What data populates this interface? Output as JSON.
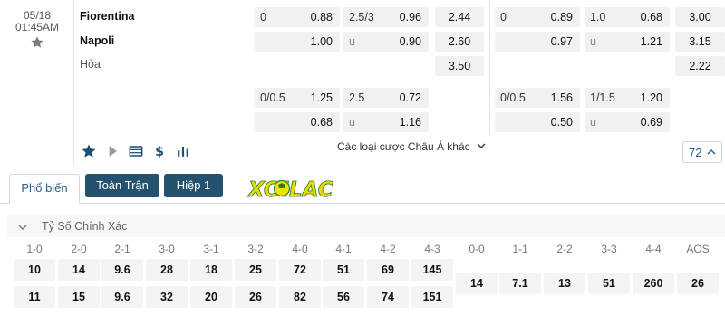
{
  "match": {
    "date": "05/18",
    "time": "01:45AM",
    "home": "Fiorentina",
    "away": "Napoli",
    "draw_label": "Hòa"
  },
  "odds": {
    "ft_hdp": {
      "line": "0",
      "home": "0.88",
      "away": "1.00"
    },
    "ft_ou": {
      "line": "2.5/3",
      "over": "0.96",
      "under_label": "u",
      "under": "0.90"
    },
    "ft_1x2": {
      "home": "2.44",
      "away": "2.60",
      "draw": "3.50"
    },
    "h1_hdp": {
      "line": "0",
      "home": "0.89",
      "away": "0.97"
    },
    "h1_ou": {
      "line": "1.0",
      "over": "0.68",
      "under_label": "u",
      "under": "1.21"
    },
    "h1_1x2": {
      "home": "3.00",
      "away": "3.15",
      "draw": "2.22"
    },
    "ft_hdp2": {
      "line": "0/0.5",
      "home": "1.25",
      "away": "0.68"
    },
    "ft_ou2": {
      "line": "2.5",
      "over": "0.72",
      "under_label": "u",
      "under": "1.16"
    },
    "h1_hdp2": {
      "line": "0/0.5",
      "home": "1.56",
      "away": "0.50"
    },
    "h1_ou2": {
      "line": "1/1.5",
      "over": "1.20",
      "under_label": "u",
      "under": "0.69"
    }
  },
  "toolbar": {
    "icons": [
      "star-icon",
      "play-icon",
      "stadium-icon",
      "dollar-icon",
      "stats-icon"
    ],
    "other_bets_label": "Các loại cược Châu Á khác",
    "market_count": "72"
  },
  "tabs": [
    {
      "label": "Phổ biến"
    },
    {
      "label": "Toàn Trận"
    },
    {
      "label": "Hiệp 1"
    }
  ],
  "logo_text": "XOILAC",
  "correct_score": {
    "title": "Tỷ Số Chính Xác",
    "home_wins": [
      {
        "score": "1-0",
        "home": "10",
        "away": "11"
      },
      {
        "score": "2-0",
        "home": "14",
        "away": "15"
      },
      {
        "score": "2-1",
        "home": "9.6",
        "away": "9.6"
      },
      {
        "score": "3-0",
        "home": "28",
        "away": "32"
      },
      {
        "score": "3-1",
        "home": "18",
        "away": "20"
      },
      {
        "score": "3-2",
        "home": "25",
        "away": "26"
      },
      {
        "score": "4-0",
        "home": "72",
        "away": "82"
      },
      {
        "score": "4-1",
        "home": "51",
        "away": "56"
      },
      {
        "score": "4-2",
        "home": "69",
        "away": "74"
      },
      {
        "score": "4-3",
        "home": "145",
        "away": "151"
      }
    ],
    "draws": [
      {
        "score": "0-0",
        "odds": "14"
      },
      {
        "score": "1-1",
        "odds": "7.1"
      },
      {
        "score": "2-2",
        "odds": "13"
      },
      {
        "score": "3-3",
        "odds": "51"
      },
      {
        "score": "4-4",
        "odds": "260"
      },
      {
        "score": "AOS",
        "odds": "26"
      }
    ]
  },
  "colors": {
    "accent": "#24526e",
    "link": "#2a5d8a",
    "cell_bg": "#f1f1f1"
  }
}
